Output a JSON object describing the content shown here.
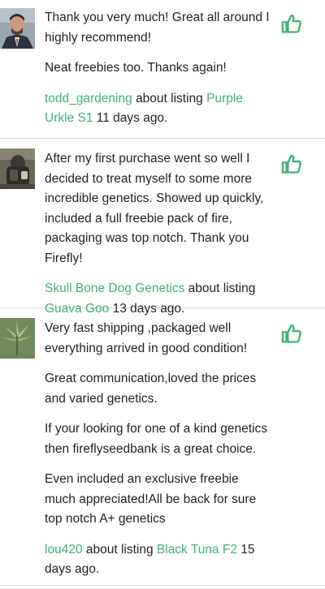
{
  "reviews": [
    {
      "avatar": "person-in-suit-avatar",
      "paragraphs": [
        "Thank you very much! Great all around I highly recommend!",
        "Neat freebies too. Thanks again!"
      ],
      "user": "todd_gardening",
      "about_text": "about listing",
      "listing": "Purple Urkle S1",
      "time": "11 days ago."
    },
    {
      "avatar": "person-with-backpack-avatar",
      "paragraphs": [
        "After my first purchase went so well I decided to treat myself to some more incredible genetics. Showed up quickly, included a full freebie pack of fire, packaging was top notch. Thank you Firefly!"
      ],
      "user": "Skull Bone Dog Genetics",
      "about_text": "about listing",
      "listing": "Guava Goo",
      "time": "13 days ago."
    },
    {
      "avatar": "cannabis-plant-avatar",
      "paragraphs": [
        "Very fast shipping ,packaged well everything arrived in good condition!",
        "Great communication,loved the prices and varied genetics.",
        "If your looking for one of a kind genetics then fireflyseedbank is a great choice.",
        "Even included an exclusive freebie much appreciated!All be back for sure top notch A+ genetics"
      ],
      "user": "lou420",
      "about_text": "about listing",
      "listing": "Black Tuna F2",
      "time": "15 days ago."
    }
  ],
  "icons": {
    "thumb": "thumbs-up-icon"
  },
  "colors": {
    "accent": "#3cb371",
    "text": "#222222",
    "divider": "#d9d9d9"
  }
}
